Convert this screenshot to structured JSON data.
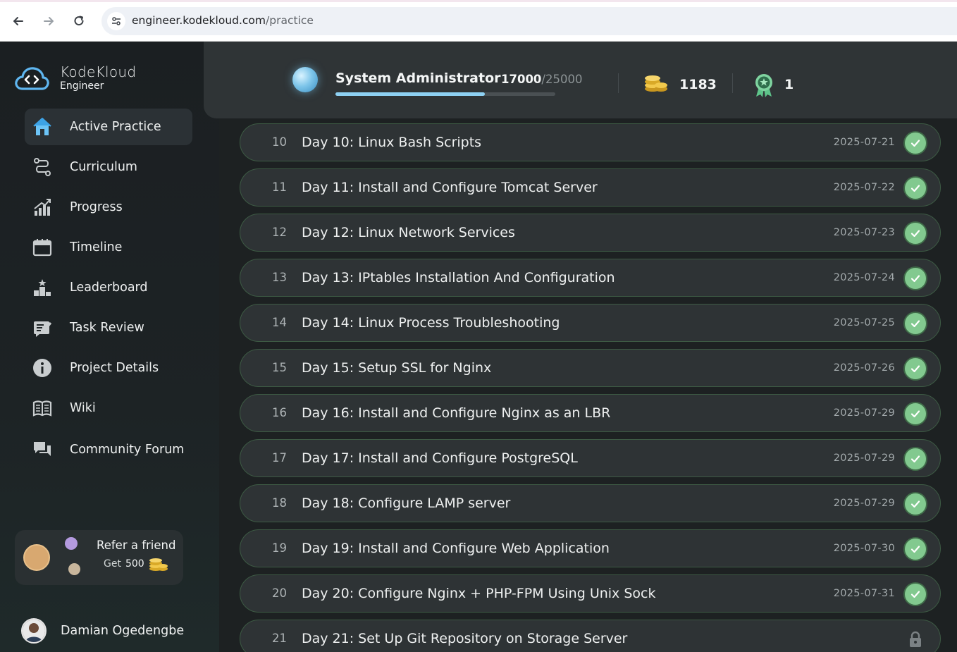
{
  "browser": {
    "url_host": "engineer.kodekloud.com",
    "url_path": "/practice"
  },
  "brand": {
    "name": "KodeKloud",
    "subtitle": "Engineer"
  },
  "sidebar": {
    "items": [
      {
        "label": "Active Practice",
        "icon": "home-icon",
        "active": true
      },
      {
        "label": "Curriculum",
        "icon": "route-icon",
        "active": false
      },
      {
        "label": "Progress",
        "icon": "progress-chart-icon",
        "active": false
      },
      {
        "label": "Timeline",
        "icon": "calendar-icon",
        "active": false
      },
      {
        "label": "Leaderboard",
        "icon": "podium-icon",
        "active": false
      },
      {
        "label": "Task Review",
        "icon": "review-icon",
        "active": false
      },
      {
        "label": "Project Details",
        "icon": "info-icon",
        "active": false
      },
      {
        "label": "Wiki",
        "icon": "book-icon",
        "active": false
      },
      {
        "label": "Community Forum",
        "icon": "chat-icon",
        "active": false
      }
    ],
    "refer": {
      "title": "Refer a friend",
      "get_label": "Get",
      "amount": "500"
    },
    "user": {
      "name": "Damian Ogedengbe"
    }
  },
  "stats": {
    "role": "System Administrator",
    "xp_current": "17000",
    "xp_total": "/25000",
    "xp_fraction": 0.68,
    "coins": "1183",
    "badges": "1"
  },
  "tasks": [
    {
      "num": "10",
      "title": "Day 10: Linux Bash Scripts",
      "date": "2025-07-21",
      "status": "done"
    },
    {
      "num": "11",
      "title": "Day 11: Install and Configure Tomcat Server",
      "date": "2025-07-22",
      "status": "done"
    },
    {
      "num": "12",
      "title": "Day 12: Linux Network Services",
      "date": "2025-07-23",
      "status": "done"
    },
    {
      "num": "13",
      "title": "Day 13: IPtables Installation And Configuration",
      "date": "2025-07-24",
      "status": "done"
    },
    {
      "num": "14",
      "title": "Day 14: Linux Process Troubleshooting",
      "date": "2025-07-25",
      "status": "done"
    },
    {
      "num": "15",
      "title": "Day 15: Setup SSL for Nginx",
      "date": "2025-07-26",
      "status": "done"
    },
    {
      "num": "16",
      "title": "Day 16: Install and Configure Nginx as an LBR",
      "date": "2025-07-29",
      "status": "done"
    },
    {
      "num": "17",
      "title": "Day 17: Install and Configure PostgreSQL",
      "date": "2025-07-29",
      "status": "done"
    },
    {
      "num": "18",
      "title": "Day 18: Configure LAMP server",
      "date": "2025-07-29",
      "status": "done"
    },
    {
      "num": "19",
      "title": "Day 19: Install and Configure Web Application",
      "date": "2025-07-30",
      "status": "done"
    },
    {
      "num": "20",
      "title": "Day 20: Configure Nginx + PHP-FPM Using Unix Sock",
      "date": "2025-07-31",
      "status": "done"
    },
    {
      "num": "21",
      "title": "Day 21: Set Up Git Repository on Storage Server",
      "date": "",
      "status": "locked"
    }
  ],
  "colors": {
    "accent": "#8ed1f3",
    "done": "#82c98f",
    "row_border": "#3d5a44"
  }
}
